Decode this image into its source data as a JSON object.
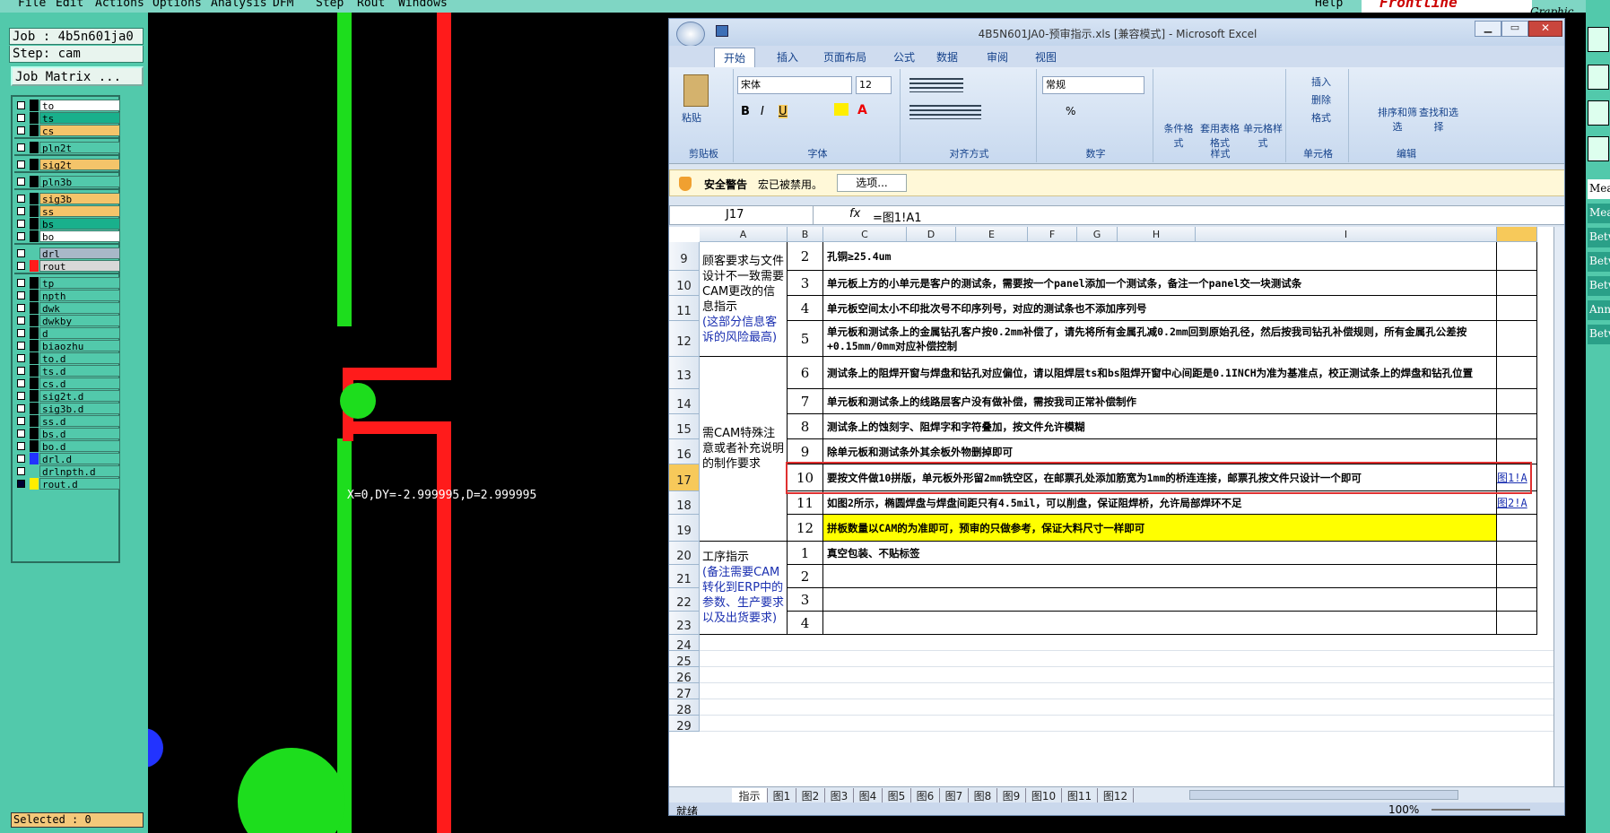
{
  "cam": {
    "menu": [
      "File",
      "Edit",
      "Actions",
      "Options",
      "Analysis",
      "DFM",
      "Step",
      "Rout",
      "Windows"
    ],
    "help": "Help",
    "brand": "Frontline",
    "edition": "Graphic Editor",
    "job_label": "Job : 4b5n601ja0",
    "step_label": "Step: cam",
    "job_matrix_button": "Job Matrix ...",
    "layers": [
      {
        "name": "to",
        "bg": "#ffffff"
      },
      {
        "name": "ts",
        "bg": "#19b08c"
      },
      {
        "name": "cs",
        "bg": "#f4c46a"
      },
      {
        "name": "pln2t",
        "bg": "#52c9ab"
      },
      {
        "name": "sig2t",
        "bg": "#f4c46a"
      },
      {
        "name": "pln3b",
        "bg": "#52c9ab"
      },
      {
        "name": "sig3b",
        "bg": "#f4c46a"
      },
      {
        "name": "ss",
        "bg": "#f4c46a"
      },
      {
        "name": "bs",
        "bg": "#19b08c"
      },
      {
        "name": "bo",
        "bg": "#ffffff"
      },
      {
        "name": "drl",
        "bg": "#a8b8c8"
      },
      {
        "name": "rout",
        "bg": "#d8d8d8"
      },
      {
        "name": "tp",
        "bg": "#52c9ab"
      },
      {
        "name": "npth",
        "bg": "#52c9ab"
      },
      {
        "name": "dwk",
        "bg": "#52c9ab"
      },
      {
        "name": "dwkby",
        "bg": "#52c9ab"
      },
      {
        "name": "d",
        "bg": "#52c9ab"
      },
      {
        "name": "biaozhu",
        "bg": "#52c9ab"
      },
      {
        "name": "to.d",
        "bg": "#52c9ab"
      },
      {
        "name": "ts.d",
        "bg": "#52c9ab"
      },
      {
        "name": "cs.d",
        "bg": "#52c9ab"
      },
      {
        "name": "sig2t.d",
        "bg": "#52c9ab"
      },
      {
        "name": "sig3b.d",
        "bg": "#52c9ab"
      },
      {
        "name": "ss.d",
        "bg": "#52c9ab"
      },
      {
        "name": "bs.d",
        "bg": "#52c9ab"
      },
      {
        "name": "bo.d",
        "bg": "#52c9ab"
      },
      {
        "name": "drl.d",
        "bg": "#52c9ab"
      },
      {
        "name": "drlnpth.d",
        "bg": "#52c9ab"
      },
      {
        "name": "rout.d",
        "bg": "#52c9ab"
      }
    ],
    "selected": "Selected : 0",
    "coord_readout": "X=0,DY=-2.999995,D=2.999995",
    "right_labels": [
      "Measure",
      "Meas",
      "Betwe",
      "Betwe",
      "Betwe",
      "Annul",
      "Betwe"
    ]
  },
  "excel": {
    "title": "4B5N601JA0-预审指示.xls  [兼容模式] - Microsoft Excel",
    "tabs": [
      "开始",
      "插入",
      "页面布局",
      "公式",
      "数据",
      "审阅",
      "视图"
    ],
    "clipboard": {
      "paste": "粘贴",
      "label": "剪贴板"
    },
    "font": {
      "name": "宋体",
      "size": "12",
      "label": "字体"
    },
    "align_label": "对齐方式",
    "number": {
      "format": "常规",
      "label": "数字"
    },
    "styles": {
      "cond": "条件格式",
      "table": "套用表格格式",
      "cell": "单元格样式",
      "label": "样式"
    },
    "cells": {
      "insert": "插入",
      "delete": "删除",
      "format": "格式",
      "label": "单元格"
    },
    "editing": {
      "sort": "排序和筛选",
      "find": "查找和选择",
      "label": "编辑"
    },
    "warning": {
      "title": "安全警告",
      "text": "宏已被禁用。",
      "button": "选项..."
    },
    "namebox": "J17",
    "formula": "=图1!A1",
    "columns": [
      "A",
      "B",
      "C",
      "D",
      "E",
      "F",
      "G",
      "H",
      "I"
    ],
    "rows": [
      "9",
      "10",
      "11",
      "12",
      "13",
      "14",
      "15",
      "16",
      "17",
      "18",
      "19",
      "20",
      "21",
      "22",
      "23",
      "24",
      "25",
      "26",
      "27",
      "28",
      "29"
    ],
    "group1": "顾客要求与文件设计不一致需要CAM更改的信息指示",
    "group1_note": "(这部分信息客诉的风险最高)",
    "group2": "需CAM特殊注意或者补充说明的制作要求",
    "group3": "工序指示",
    "group3_note": "(备注需要CAM转化到ERP中的参数、生产要求以及出货要求)",
    "items": [
      {
        "n": "2",
        "t": "孔铜≥25.4um"
      },
      {
        "n": "3",
        "t": "单元板上方的小单元是客户的测试条，需要按一个panel添加一个测试条，备注一个panel交一块测试条"
      },
      {
        "n": "4",
        "t": "单元板空间太小不印批次号不印序列号，对应的测试条也不添加序列号"
      },
      {
        "n": "5",
        "t": "单元板和测试条上的金属钻孔客户按0.2mm补偿了，请先将所有金属孔减0.2mm回到原始孔径，然后按我司钻孔补偿规则，所有金属孔公差按+0.15mm/0mm对应补偿控制"
      },
      {
        "n": "6",
        "t": "测试条上的阻焊开窗与焊盘和钻孔对应偏位，请以阻焊层ts和bs阻焊开窗中心间距是0.1INCH为准为基准点，校正测试条上的焊盘和钻孔位置"
      },
      {
        "n": "7",
        "t": "单元板和测试条上的线路层客户没有做补偿，需按我司正常补偿制作"
      },
      {
        "n": "8",
        "t": "测试条上的蚀刻字、阻焊字和字符叠加，按文件允许模糊"
      },
      {
        "n": "9",
        "t": "除单元板和测试条外其余板外物删掉即可"
      },
      {
        "n": "10",
        "t": "要按文件做10拼版，单元板外形留2mm铣空区，在邮票孔处添加筋宽为1mm的桥连连接，邮票孔按文件只设计一个即可",
        "link": "图1!A"
      },
      {
        "n": "11",
        "t": "如图2所示，椭圆焊盘与焊盘间距只有4.5mil，可以削盘，保证阻焊桥，允许局部焊环不足",
        "link": "图2!A"
      },
      {
        "n": "12",
        "t": "拼板数量以CAM的为准即可，预审的只做参考，保证大料尺寸一样即可"
      },
      {
        "n": "1",
        "t": "真空包装、不贴标签"
      },
      {
        "n": "2",
        "t": ""
      },
      {
        "n": "3",
        "t": ""
      },
      {
        "n": "4",
        "t": ""
      }
    ],
    "sheet_tabs": [
      "指示",
      "图1",
      "图2",
      "图3",
      "图4",
      "图5",
      "图6",
      "图7",
      "图8",
      "图9",
      "图10",
      "图11",
      "图12"
    ],
    "status": "就绪",
    "zoom": "100%",
    "highlight_color": "#ffff00",
    "accent": "#e03030"
  }
}
